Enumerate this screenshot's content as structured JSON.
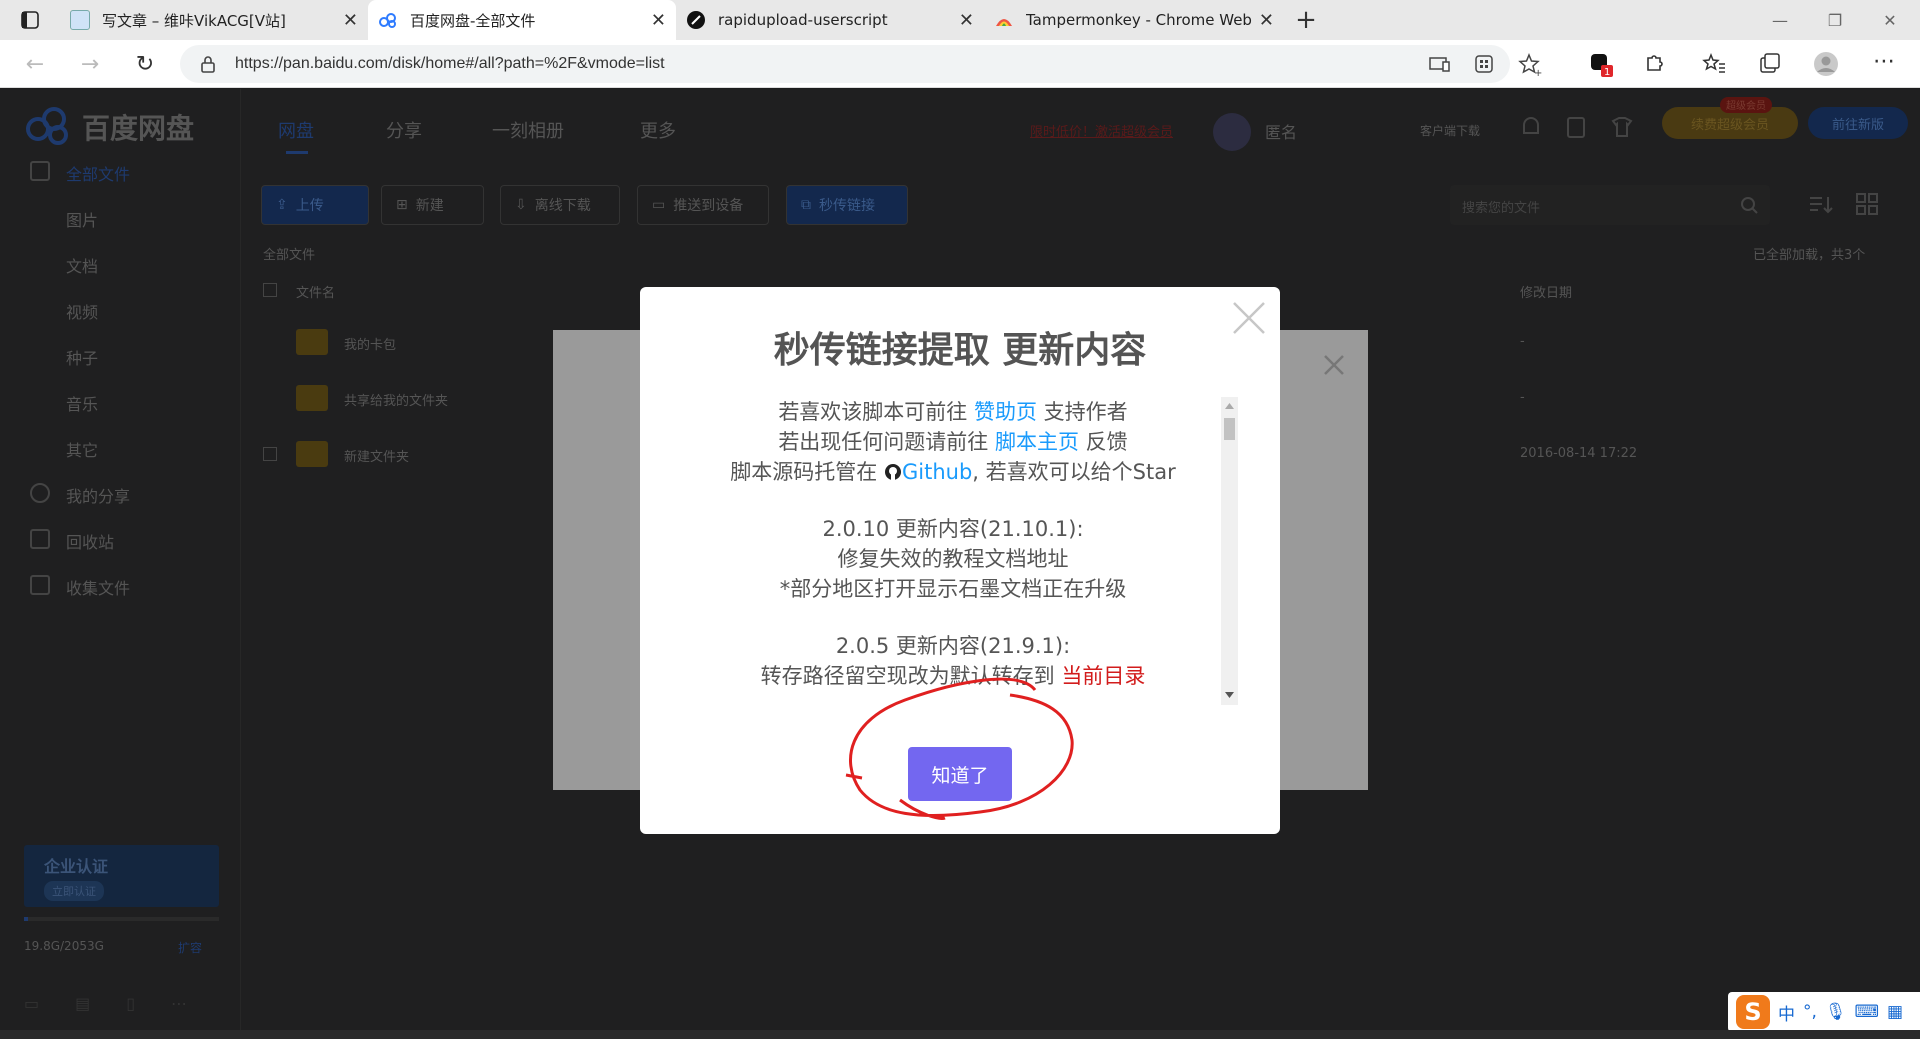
{
  "browser": {
    "tabs": [
      {
        "title": "写文章 – 维咔VikACG[V站]",
        "favicon": "vikacg-avatar",
        "active": false
      },
      {
        "title": "百度网盘-全部文件",
        "favicon": "baidu-cloud",
        "active": true
      },
      {
        "title": "rapidupload-userscript",
        "favicon": "github",
        "active": false
      },
      {
        "title": "Tampermonkey - Chrome Web S",
        "favicon": "chrome-web-store",
        "active": false
      }
    ],
    "url": "https://pan.baidu.com/disk/home#/all?path=%2F&vmode=list",
    "extension_badge": "1"
  },
  "baidu": {
    "logo": "百度网盘",
    "nav": [
      "网盘",
      "分享",
      "一刻相册",
      "更多"
    ],
    "header_links": [
      "限时低价！激活超级会员",
      "匿名",
      "客户端下载"
    ],
    "vip_badge": "超级会员",
    "vip_btn": "续费超级会员",
    "new_btn": "前往新版",
    "sidebar": [
      "全部文件",
      "图片",
      "文档",
      "视频",
      "种子",
      "音乐",
      "其它",
      "我的分享",
      "回收站",
      "收集文件"
    ],
    "toolbar": [
      "上传",
      "新建",
      "离线下载",
      "推送到设备",
      "秒传链接"
    ],
    "search_placeholder": "搜索您的文件",
    "breadcrumb": "全部文件",
    "loaded_text": "已全部加载，共3个",
    "col_name": "文件名",
    "col_modified": "修改日期",
    "files": [
      {
        "name": "我的卡包",
        "date": "-"
      },
      {
        "name": "共享给我的文件夹",
        "date": "-"
      },
      {
        "name": "新建文件夹",
        "date": "2016-08-14 17:22"
      }
    ],
    "enterprise": "企业认证",
    "enterprise_sub": "立即认证",
    "storage": "19.8G/2053G",
    "expand": "扩容"
  },
  "modal": {
    "title": "秒传链接提取 更新内容",
    "line1_pre": "若喜欢该脚本可前往 ",
    "line1_link": "赞助页",
    "line1_post": " 支持作者",
    "line2_pre": "若出现任何问题请前往 ",
    "line2_link": "脚本主页",
    "line2_post": " 反馈",
    "line3_pre": "脚本源码托管在 ",
    "line3_link": "Github",
    "line3_post": ", 若喜欢可以给个Star",
    "v1_title": "2.0.10 更新内容(21.10.1):",
    "v1_l1": "修复失效的教程文档地址",
    "v1_l2": "*部分地区打开显示石墨文档正在升级",
    "v2_title": "2.0.5 更新内容(21.9.1):",
    "v2_l1_pre": "转存路径留空现改为默认转存到 ",
    "v2_l1_red": "当前目录",
    "ok": "知道了"
  },
  "ime": {
    "mode": "中",
    "punct": "°,"
  }
}
